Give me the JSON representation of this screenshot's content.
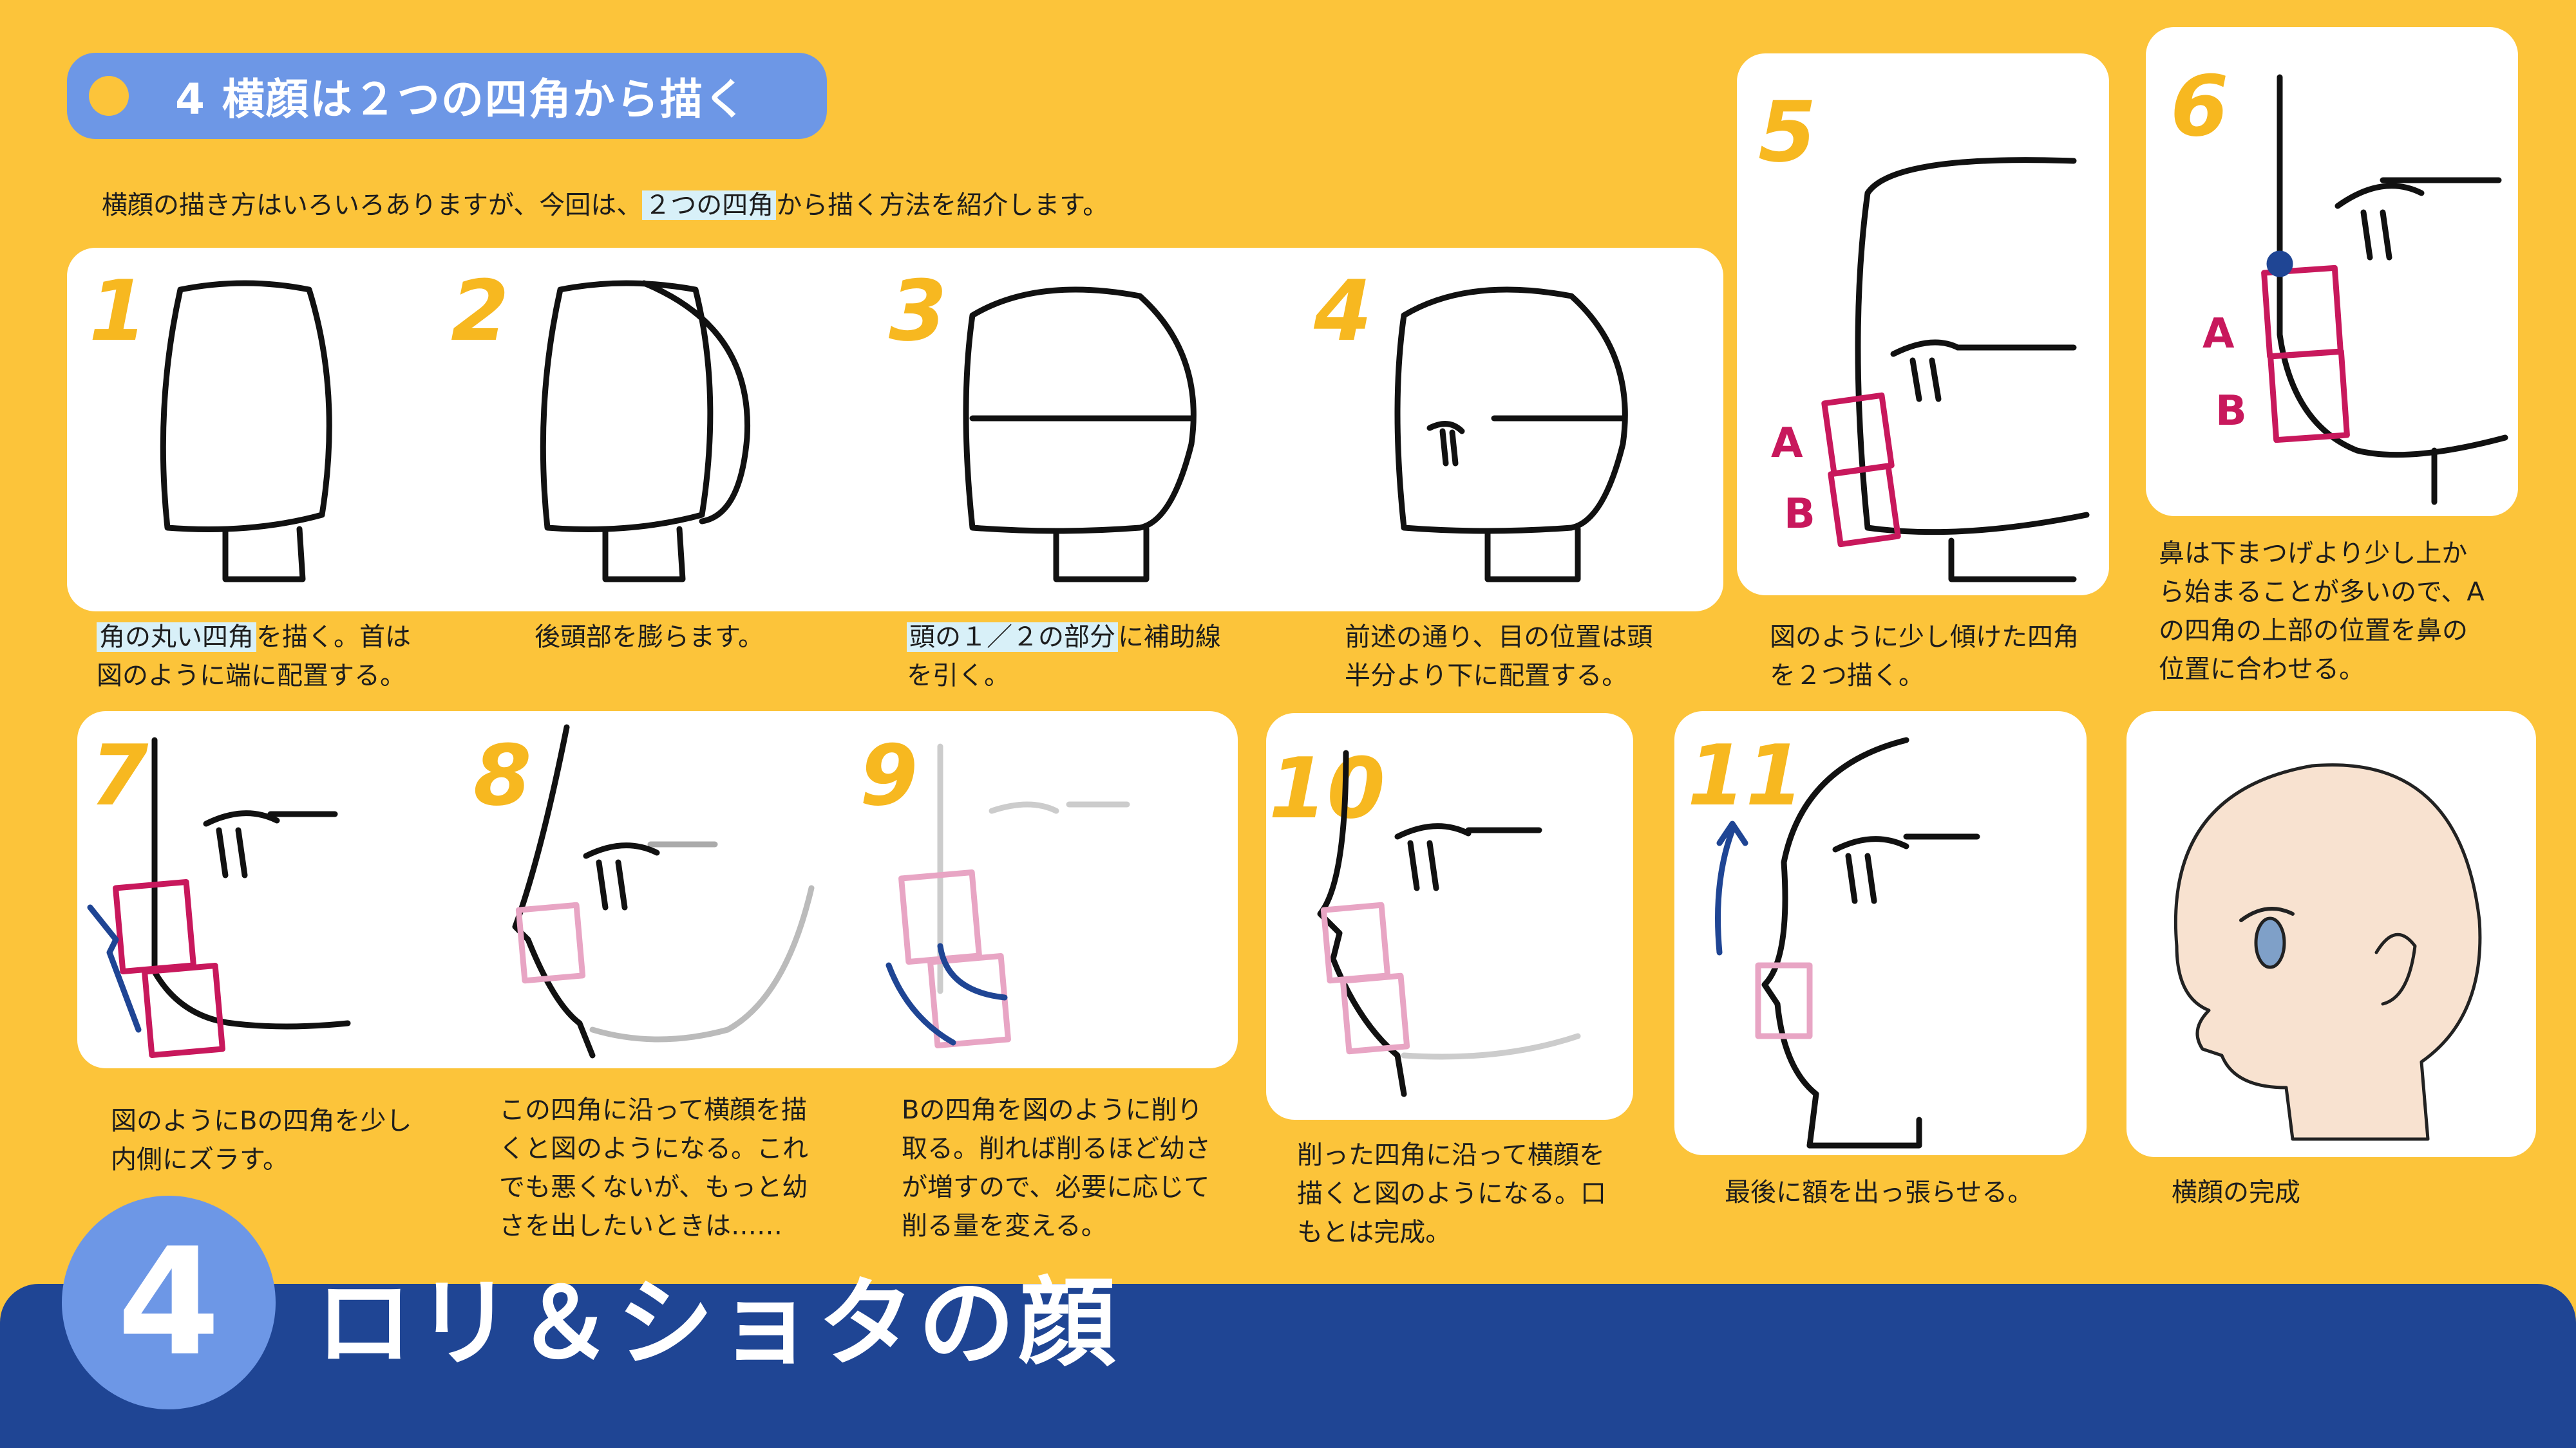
{
  "header": {
    "title": "4  横顔は２つの四角から描く"
  },
  "intro": {
    "before": "横顔の描き方はいろいろありますが、今回は、",
    "highlight": "２つの四角",
    "after": "から描く方法を紹介します。"
  },
  "steps": [
    {
      "num": "1",
      "caption_hl": "角の丸い四角",
      "caption": "を描く。首は\n図のように端に配置する。"
    },
    {
      "num": "2",
      "caption_hl": "",
      "caption": "後頭部を膨らます。"
    },
    {
      "num": "3",
      "caption_hl": "頭の１／２の部分",
      "caption": "に補助線\nを引く。"
    },
    {
      "num": "4",
      "caption_hl": "",
      "caption": "前述の通り、目の位置は頭\n半分より下に配置する。"
    },
    {
      "num": "5",
      "caption_hl": "",
      "caption": "図のように少し傾けた四角\nを２つ描く。"
    },
    {
      "num": "6",
      "caption_hl": "",
      "caption": "鼻は下まつげより少し上か\nら始まることが多いので、A\nの四角の上部の位置を鼻の\n位置に合わせる。"
    },
    {
      "num": "7",
      "caption_hl": "",
      "caption": "図のようにBの四角を少し\n内側にズラす。"
    },
    {
      "num": "8",
      "caption_hl": "",
      "caption": "この四角に沿って横顔を描\nくと図のようになる。これ\nでも悪くないが、もっと幼\nさを出したいときは……"
    },
    {
      "num": "9",
      "caption_hl": "",
      "caption": "Bの四角を図のように削り\n取る。削れば削るほど幼さ\nが増すので、必要に応じて\n削る量を変える。"
    },
    {
      "num": "10",
      "caption_hl": "",
      "caption": "削った四角に沿って横顔を\n描くと図のようになる。口\nもとは完成。"
    },
    {
      "num": "11",
      "caption_hl": "",
      "caption": "最後に額を出っ張らせる。"
    },
    {
      "num": "",
      "caption_hl": "",
      "caption": "横顔の完成"
    }
  ],
  "labels": {
    "a": "A",
    "b": "B"
  },
  "footer": {
    "number": "4",
    "title": "ロリ＆ショタの顔"
  },
  "colors": {
    "background": "#fcc43a",
    "accent_blue": "#6d97e6",
    "footer_navy": "#1f4594",
    "box_magenta": "#c8185c",
    "arrow_blue": "#1f4594",
    "skin": "#f8e2d0"
  }
}
